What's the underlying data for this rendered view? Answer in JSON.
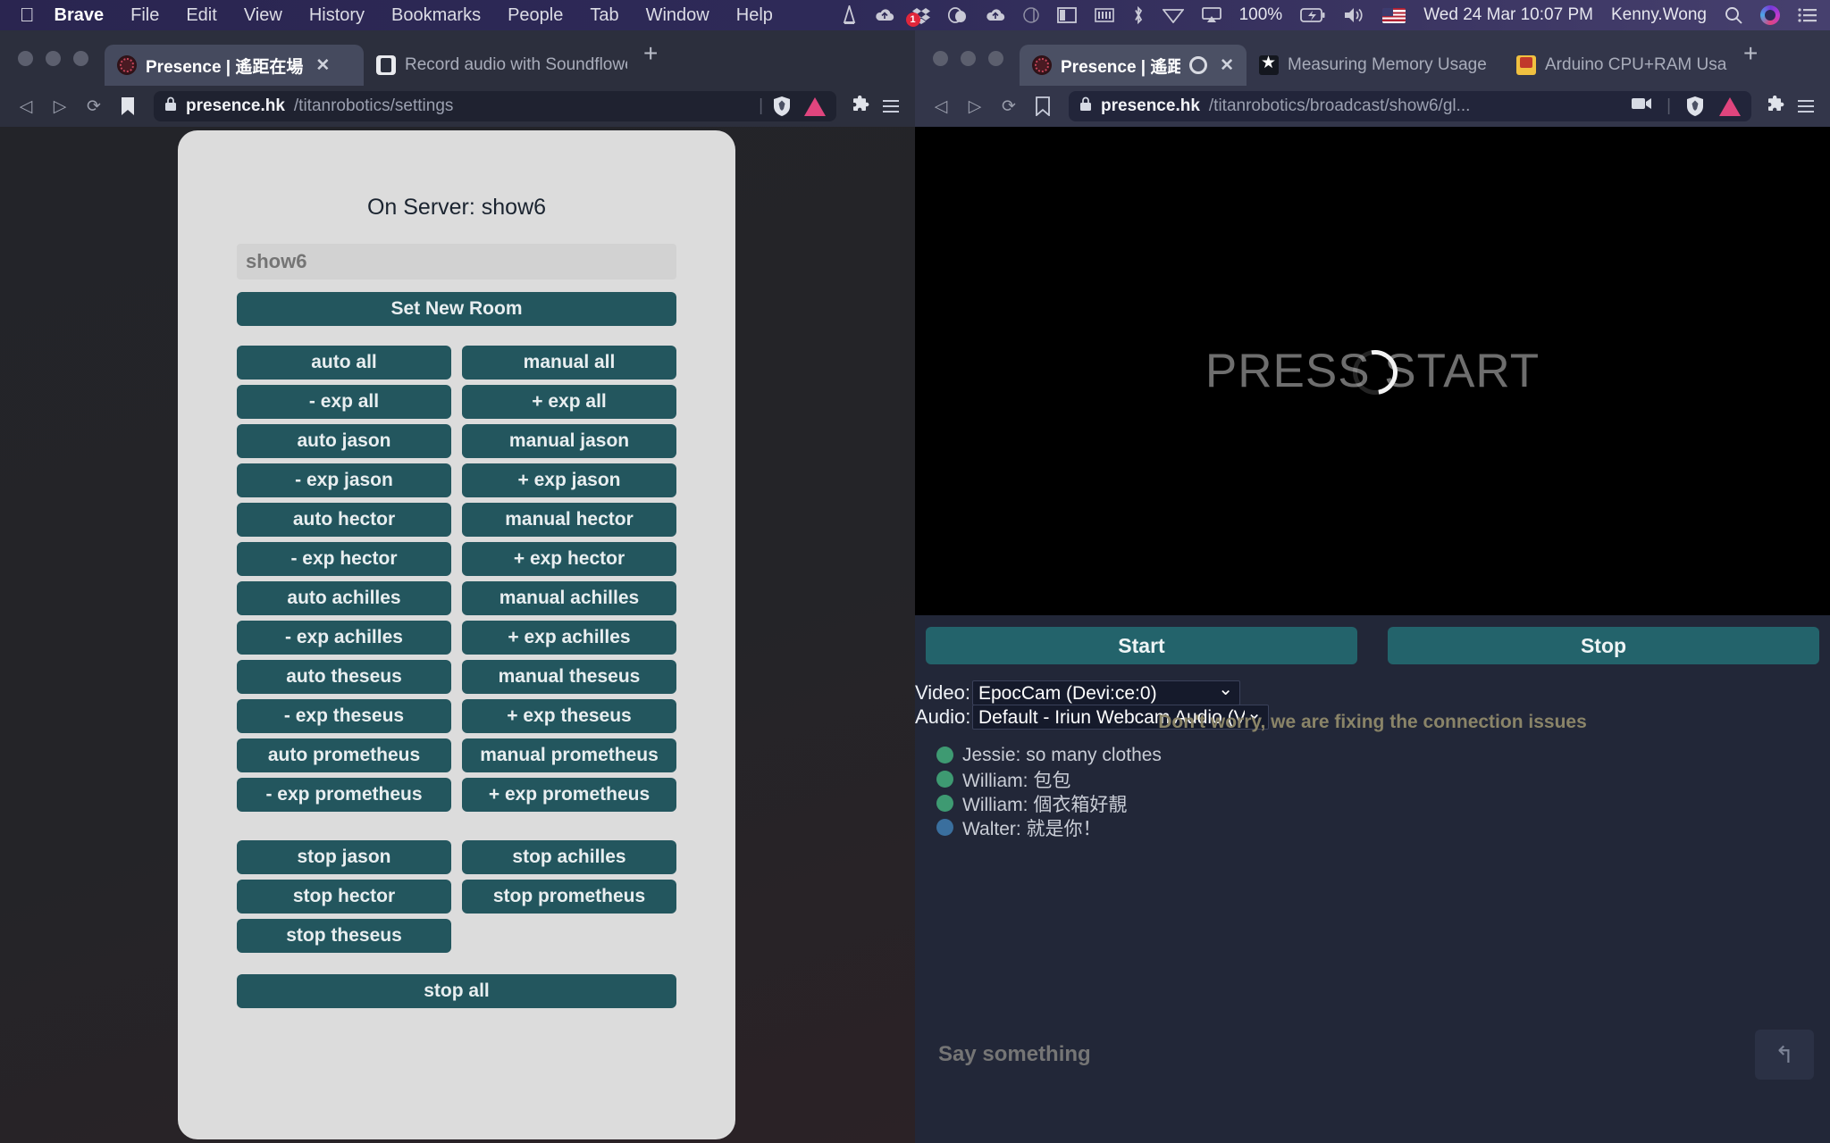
{
  "menubar": {
    "apple": "apple-logo",
    "items": [
      "Brave",
      "File",
      "Edit",
      "View",
      "History",
      "Bookmarks",
      "People",
      "Tab",
      "Window",
      "Help"
    ],
    "status_icons": [
      "vlc-cone-icon",
      "upload-cloud-icon",
      "dropbox-icon",
      "grammarly-icon",
      "upload-cloud2-icon",
      "dictionary-icon",
      "magnet-window-icon",
      "battery-bars-icon",
      "bluetooth-icon",
      "wifi-icon",
      "airplay-icon"
    ],
    "dropbox_badge": "1",
    "battery_percent": "100%",
    "battery_icon": "battery-charging-icon",
    "volume_icon": "speaker-icon",
    "input_flag": "us-flag-icon",
    "datetime": "Wed 24 Mar  10:07 PM",
    "user": "Kenny.Wong",
    "search_icon": "spotlight-search-icon",
    "siri_icon": "siri-icon",
    "controlcenter_icon": "notification-center-icon"
  },
  "left_window": {
    "tabs": [
      {
        "title": "Presence | 遙距在場",
        "favicon": "presence-favicon",
        "active": true,
        "close": "✕"
      },
      {
        "title": "Record audio with Soundflower | Ch",
        "favicon": "phone-favicon",
        "active": false,
        "close": ""
      }
    ],
    "newtab_label": "+",
    "nav": {
      "back": "◁",
      "forward": "▷",
      "reload": "⟳",
      "bookmark": "bookmark-icon"
    },
    "url": {
      "lock": "lock-icon",
      "host": "presence.hk",
      "path": "/titanrobotics/settings"
    },
    "toolbar_icons": [
      "brave-shield-icon",
      "brave-rewards-icon",
      "extensions-puzzle-icon",
      "brave-menu-icon"
    ]
  },
  "right_window": {
    "tabs": [
      {
        "title": "Presence | 遙距在場",
        "favicon": "presence-favicon",
        "active": true,
        "recording": "record-indicator",
        "close": "✕"
      },
      {
        "title": "Measuring Memory Usage",
        "favicon": "star-favicon",
        "active": false,
        "close": ""
      },
      {
        "title": "Arduino CPU+RAM Usage",
        "favicon": "arduino-favicon",
        "active": false,
        "close": ""
      }
    ],
    "newtab_label": "+",
    "nav": {
      "back": "◁",
      "forward": "▷",
      "reload": "⟳",
      "bookmark": "bookmark-icon"
    },
    "url": {
      "lock": "lock-icon",
      "host": "presence.hk",
      "path": "/titanrobotics/broadcast/show6/gl..."
    },
    "toolbar_icons": [
      "camera-active-icon",
      "brave-shield-icon",
      "brave-rewards-icon",
      "extensions-puzzle-icon",
      "brave-menu-icon"
    ]
  },
  "settings_page": {
    "server_title": "On Server: show6",
    "room_input_placeholder": "show6",
    "room_input_value": "",
    "set_room_label": "Set New Room",
    "control_rows": [
      {
        "left": "auto all",
        "right": "manual all"
      },
      {
        "left": "- exp all",
        "right": "+ exp all"
      },
      {
        "left": "auto jason",
        "right": "manual jason"
      },
      {
        "left": "- exp jason",
        "right": "+ exp jason"
      },
      {
        "left": "auto hector",
        "right": "manual hector"
      },
      {
        "left": "- exp hector",
        "right": "+ exp hector"
      },
      {
        "left": "auto achilles",
        "right": "manual achilles"
      },
      {
        "left": "- exp achilles",
        "right": "+ exp achilles"
      },
      {
        "left": "auto theseus",
        "right": "manual theseus"
      },
      {
        "left": "- exp theseus",
        "right": "+ exp theseus"
      },
      {
        "left": "auto prometheus",
        "right": "manual prometheus"
      },
      {
        "left": "- exp prometheus",
        "right": "+ exp prometheus"
      }
    ],
    "stop_rows": [
      {
        "left": "stop jason",
        "right": "stop achilles"
      },
      {
        "left": "stop hector",
        "right": "stop prometheus"
      },
      {
        "left": "stop theseus",
        "right": ""
      }
    ],
    "stop_all_label": "stop all",
    "accent_color": "#23565e",
    "card_bg": "#dcdcdc"
  },
  "broadcast_page": {
    "video_placeholder": "PRESS START",
    "spinner": "loading-spinner",
    "start_label": "Start",
    "stop_label": "Stop",
    "video_device": {
      "label": "Video:",
      "value": "EpocCam (Devi:ce:0)"
    },
    "audio_device": {
      "label": "Audio:",
      "value": "Default - Iriun Webcam Audio (Virtual)"
    },
    "banner": "Don't worry, we are fixing the connection issues",
    "messages": [
      {
        "color": "#3e9a72",
        "text": "Jessie: so many clothes"
      },
      {
        "color": "#3e9a72",
        "text": "William: 包包"
      },
      {
        "color": "#3e9a72",
        "text": "William: 個衣箱好靚"
      },
      {
        "color": "#3a6f9e",
        "text": "Walter: 就是你！"
      }
    ],
    "say_placeholder": "Say something",
    "say_value": "",
    "send_icon": "↰",
    "accent_color": "#23636b"
  }
}
